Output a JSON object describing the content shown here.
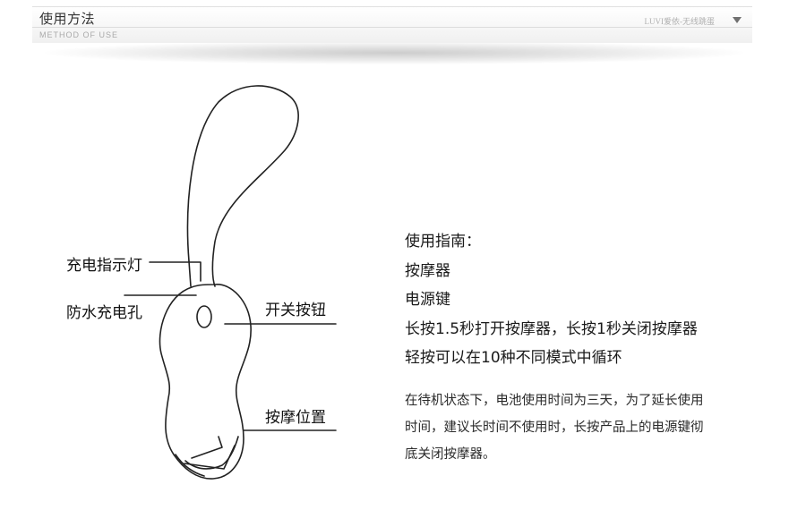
{
  "header": {
    "title": "使用方法",
    "subtitle": "METHOD OF USE",
    "brand": "LUVI爱依-无线跳蛋",
    "dropdown_icon": "chevron-down-icon"
  },
  "diagram": {
    "labels": {
      "charge_indicator": "充电指示灯",
      "waterproof_port": "防水充电孔",
      "power_button": "开关按钮",
      "massage_position": "按摩位置"
    },
    "line_color": "#222222"
  },
  "guide": {
    "heading": "使用指南：",
    "items": [
      "按摩器",
      "电源键",
      "长按1.5秒打开按摩器，长按1秒关闭按摩器",
      "轻按可以在10种不同模式中循环"
    ]
  },
  "note": {
    "lines": [
      "在待机状态下，电池使用时间为三天，为了延长使用",
      "时间，建议长时间不使用时，长按产品上的电源键彻",
      "底关闭按摩器。"
    ]
  }
}
